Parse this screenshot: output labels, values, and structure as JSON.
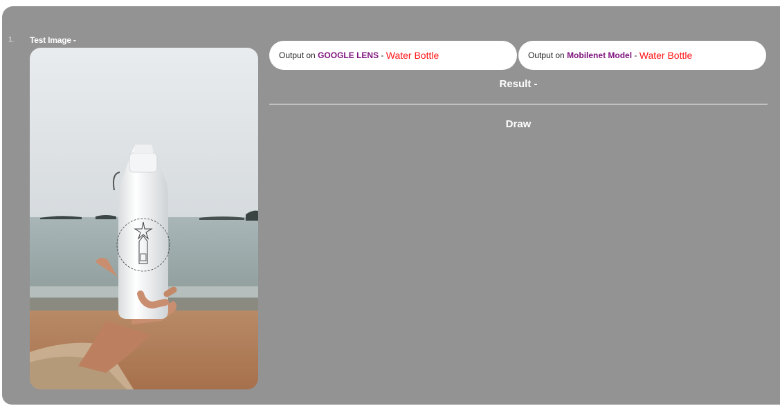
{
  "item": {
    "number": "1.",
    "heading": "Test Image -",
    "image_alt": "photo-hand-holding-water-bottle"
  },
  "outputs": [
    {
      "prefix": "Output on ",
      "model": "GOOGLE LENS",
      "separator": " - ",
      "answer": "Water Bottle"
    },
    {
      "prefix": "Output on ",
      "model": "Mobilenet Model",
      "separator": " - ",
      "answer": "Water Bottle"
    }
  ],
  "result": {
    "heading": "Result -",
    "value": "Draw"
  },
  "colors": {
    "panel": "#939393",
    "model_label": "#7d127d",
    "answer": "#ff1414",
    "pill_bg": "#ffffff"
  }
}
